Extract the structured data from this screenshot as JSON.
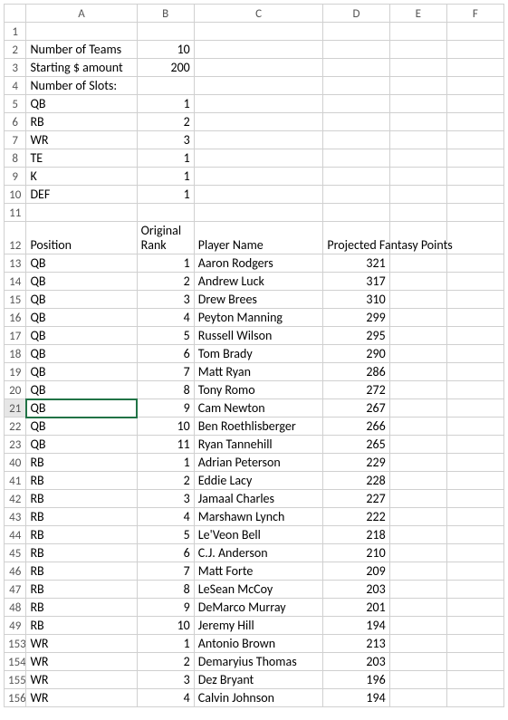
{
  "columns": [
    "A",
    "B",
    "C",
    "D",
    "E",
    "F"
  ],
  "selected_row": 21,
  "selected_col": "A",
  "top_rows": [
    {
      "n": 1,
      "A": "",
      "B": "",
      "C": "",
      "D": "",
      "E": "",
      "F": ""
    },
    {
      "n": 2,
      "A": "Number of Teams",
      "B": "10",
      "bn": true,
      "C": "",
      "D": "",
      "E": "",
      "F": ""
    },
    {
      "n": 3,
      "A": "Starting $ amount",
      "B": "200",
      "bn": true,
      "C": "",
      "D": "",
      "E": "",
      "F": ""
    },
    {
      "n": 4,
      "A": "Number of Slots:",
      "B": "",
      "C": "",
      "D": "",
      "E": "",
      "F": ""
    },
    {
      "n": 5,
      "A": "QB",
      "B": "1",
      "bn": true,
      "C": "",
      "D": "",
      "E": "",
      "F": ""
    },
    {
      "n": 6,
      "A": "RB",
      "B": "2",
      "bn": true,
      "C": "",
      "D": "",
      "E": "",
      "F": ""
    },
    {
      "n": 7,
      "A": "WR",
      "B": "3",
      "bn": true,
      "C": "",
      "D": "",
      "E": "",
      "F": ""
    },
    {
      "n": 8,
      "A": "TE",
      "B": "1",
      "bn": true,
      "C": "",
      "D": "",
      "E": "",
      "F": ""
    },
    {
      "n": 9,
      "A": "K",
      "B": "1",
      "bn": true,
      "C": "",
      "D": "",
      "E": "",
      "F": ""
    },
    {
      "n": 10,
      "A": "DEF",
      "B": "1",
      "bn": true,
      "C": "",
      "D": "",
      "E": "",
      "F": ""
    },
    {
      "n": 11,
      "A": "",
      "B": "",
      "C": "",
      "D": "",
      "E": "",
      "F": ""
    }
  ],
  "header_row": {
    "n": 12,
    "A": "Position",
    "B": "Original Rank",
    "C": "Player Name",
    "D": "Projected Fantasy Points",
    "E": "",
    "F": ""
  },
  "data_rows": [
    {
      "n": 13,
      "A": "QB",
      "B": 1,
      "C": "Aaron Rodgers",
      "D": 321
    },
    {
      "n": 14,
      "A": "QB",
      "B": 2,
      "C": "Andrew Luck",
      "D": 317
    },
    {
      "n": 15,
      "A": "QB",
      "B": 3,
      "C": "Drew Brees",
      "D": 310
    },
    {
      "n": 16,
      "A": "QB",
      "B": 4,
      "C": "Peyton Manning",
      "D": 299
    },
    {
      "n": 17,
      "A": "QB",
      "B": 5,
      "C": "Russell Wilson",
      "D": 295
    },
    {
      "n": 18,
      "A": "QB",
      "B": 6,
      "C": "Tom Brady",
      "D": 290
    },
    {
      "n": 19,
      "A": "QB",
      "B": 7,
      "C": "Matt Ryan",
      "D": 286
    },
    {
      "n": 20,
      "A": "QB",
      "B": 8,
      "C": "Tony Romo",
      "D": 272
    },
    {
      "n": 21,
      "A": "QB",
      "B": 9,
      "C": "Cam Newton",
      "D": 267
    },
    {
      "n": 22,
      "A": "QB",
      "B": 10,
      "C": "Ben Roethlisberger",
      "D": 266
    },
    {
      "n": 23,
      "A": "QB",
      "B": 11,
      "C": "Ryan Tannehill",
      "D": 265
    },
    {
      "n": 40,
      "A": "RB",
      "B": 1,
      "C": "Adrian Peterson",
      "D": 229
    },
    {
      "n": 41,
      "A": "RB",
      "B": 2,
      "C": "Eddie Lacy",
      "D": 228
    },
    {
      "n": 42,
      "A": "RB",
      "B": 3,
      "C": "Jamaal Charles",
      "D": 227
    },
    {
      "n": 43,
      "A": "RB",
      "B": 4,
      "C": "Marshawn Lynch",
      "D": 222
    },
    {
      "n": 44,
      "A": "RB",
      "B": 5,
      "C": "Le'Veon Bell",
      "D": 218
    },
    {
      "n": 45,
      "A": "RB",
      "B": 6,
      "C": "C.J. Anderson",
      "D": 210
    },
    {
      "n": 46,
      "A": "RB",
      "B": 7,
      "C": "Matt Forte",
      "D": 209
    },
    {
      "n": 47,
      "A": "RB",
      "B": 8,
      "C": "LeSean McCoy",
      "D": 203
    },
    {
      "n": 48,
      "A": "RB",
      "B": 9,
      "C": "DeMarco Murray",
      "D": 201
    },
    {
      "n": 49,
      "A": "RB",
      "B": 10,
      "C": "Jeremy Hill",
      "D": 194
    },
    {
      "n": 153,
      "A": "WR",
      "B": 1,
      "C": "Antonio Brown",
      "D": 213
    },
    {
      "n": 154,
      "A": "WR",
      "B": 2,
      "C": "Demaryius Thomas",
      "D": 203
    },
    {
      "n": 155,
      "A": "WR",
      "B": 3,
      "C": "Dez Bryant",
      "D": 196
    },
    {
      "n": 156,
      "A": "WR",
      "B": 4,
      "C": "Calvin Johnson",
      "D": 194
    }
  ]
}
